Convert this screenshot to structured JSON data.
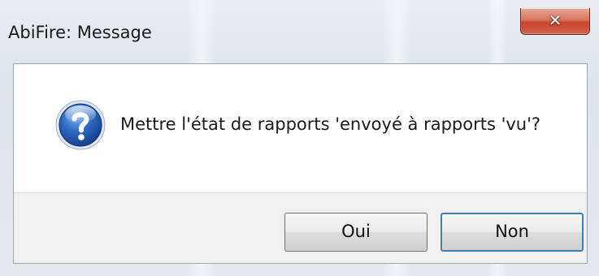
{
  "window": {
    "title": "AbiFire: Message"
  },
  "title_bar": {
    "close_glyph": "✕"
  },
  "message": {
    "icon": "question-icon",
    "text": "Mettre l'état de rapports 'envoyé à rapports 'vu'?"
  },
  "buttons": {
    "yes_label": "Oui",
    "no_label": "Non"
  },
  "colors": {
    "close_button": "#c8452c",
    "icon_blue": "#1f4fa0",
    "default_button_border": "#3c7fb1"
  }
}
